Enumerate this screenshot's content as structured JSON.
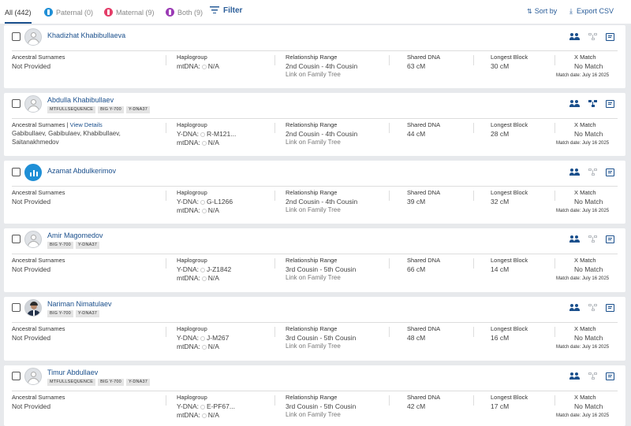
{
  "toolbar": {
    "tabs": [
      {
        "label": "All (442)"
      },
      {
        "label": "Paternal (0)"
      },
      {
        "label": "Maternal (9)"
      },
      {
        "label": "Both (9)"
      }
    ],
    "filter_label": "Filter",
    "sort_label": "Sort by",
    "export_label": "Export CSV"
  },
  "labels": {
    "ancestral_surnames": "Ancestral Surnames",
    "view_details": "View Details",
    "haplogroup": "Haplogroup",
    "relationship_range": "Relationship Range",
    "shared_dna": "Shared DNA",
    "longest_block": "Longest Block",
    "x_match": "X Match",
    "link_on_family_tree": "Link on Family Tree",
    "ydna_prefix": "Y-DNA:",
    "mtdna_prefix": "mtDNA:"
  },
  "colors": {
    "accent": "#1a4f8c",
    "paternal": "#1f8fd6",
    "maternal": "#e43d68",
    "both": "#9b3bb5"
  },
  "matches": [
    {
      "name": "Khadizhat Khabibullaeva",
      "avatar": "default",
      "badges": [],
      "surnames": [
        "Not Provided"
      ],
      "ydna": "",
      "mtdna": "N/A",
      "relationship": "2nd Cousin - 4th Cousin",
      "link_tree": true,
      "shared_dna": "63 cM",
      "longest_block": "30 cM",
      "x_match": "No Match",
      "match_date": "Match date: July 16 2025",
      "tree_active": false
    },
    {
      "name": "Abdulla Khabibullaev",
      "avatar": "default",
      "badges": [
        "MTFULLSEQUENCE",
        "BIG Y-700",
        "Y-DNA37"
      ],
      "surnames": [
        "Gabibullaev, Gabibulaev, Khabibullaev,",
        "Saitanakhmedov"
      ],
      "view_details": true,
      "ydna": "R-M121...",
      "mtdna": "N/A",
      "relationship": "2nd Cousin - 4th Cousin",
      "link_tree": true,
      "shared_dna": "44 cM",
      "longest_block": "28 cM",
      "x_match": "No Match",
      "match_date": "Match date: July 16 2025",
      "tree_active": true
    },
    {
      "name": "Azamat Abdulkerimov",
      "avatar": "blue",
      "badges": [],
      "surnames": [
        "Not Provided"
      ],
      "ydna": "G-L1266",
      "mtdna": "N/A",
      "relationship": "2nd Cousin - 4th Cousin",
      "link_tree": true,
      "shared_dna": "39 cM",
      "longest_block": "32 cM",
      "x_match": "No Match",
      "match_date": "Match date: July 16 2025",
      "tree_active": false
    },
    {
      "name": "Amir Magomedov",
      "avatar": "default",
      "badges": [
        "BIG Y-700",
        "Y-DNA37"
      ],
      "surnames": [
        "Not Provided"
      ],
      "ydna": "J-Z1842",
      "mtdna": "N/A",
      "relationship": "3rd Cousin - 5th Cousin",
      "link_tree": true,
      "shared_dna": "66 cM",
      "longest_block": "14 cM",
      "x_match": "No Match",
      "match_date": "Match date: July 16 2025",
      "tree_active": false
    },
    {
      "name": "Nariman Nimatulaev",
      "avatar": "photo",
      "badges": [
        "BIG Y-700",
        "Y-DNA37"
      ],
      "surnames": [
        "Not Provided"
      ],
      "ydna": "J-M267",
      "mtdna": "N/A",
      "relationship": "3rd Cousin - 5th Cousin",
      "link_tree": true,
      "shared_dna": "48 cM",
      "longest_block": "16 cM",
      "x_match": "No Match",
      "match_date": "Match date: July 16 2025",
      "tree_active": false
    },
    {
      "name": "Timur Abdullaev",
      "avatar": "default",
      "badges": [
        "MTFULLSEQUENCE",
        "BIG Y-700",
        "Y-DNA37"
      ],
      "surnames": [
        "Not Provided"
      ],
      "ydna": "E-PF67...",
      "mtdna": "N/A",
      "relationship": "3rd Cousin - 5th Cousin",
      "link_tree": true,
      "shared_dna": "42 cM",
      "longest_block": "17 cM",
      "x_match": "No Match",
      "match_date": "Match date: July 16 2025",
      "tree_active": false
    }
  ]
}
